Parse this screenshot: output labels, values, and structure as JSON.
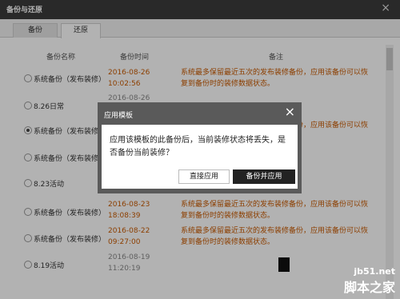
{
  "window": {
    "title": "备份与还原",
    "close": "×"
  },
  "tabs": [
    {
      "label": "备份"
    },
    {
      "label": "还原"
    }
  ],
  "table": {
    "headers": {
      "name": "备份名称",
      "time": "备份时间",
      "note": "备注"
    },
    "rows": [
      {
        "name": "系统备份（发布装修）",
        "date": "2016-08-26",
        "time": "10:02:56",
        "note": "系统最多保留最近五次的发布装修备份，应用该备份可以恢复到备份时的装修数据状态。",
        "selected": false
      },
      {
        "name": "8.26日常",
        "date": "2016-08-26",
        "time": "",
        "note": "",
        "selected": false
      },
      {
        "name": "系统备份（发布装修）",
        "date": "",
        "time": "",
        "note": "系统最多保留最近五次的发布装修备份，应用该备份可以恢复到备份时的装修数据状态。",
        "selected": true
      },
      {
        "name": "系统备份（发布装修）",
        "date": "",
        "time": "",
        "note": "",
        "selected": false
      },
      {
        "name": "8.23活动",
        "date": "",
        "time": "",
        "note": "",
        "selected": false
      },
      {
        "name": "系统备份（发布装修）",
        "date": "2016-08-23",
        "time": "18:08:39",
        "note": "系统最多保留最近五次的发布装修备份，应用该备份可以恢复到备份时的装修数据状态。",
        "selected": false
      },
      {
        "name": "系统备份（发布装修）",
        "date": "2016-08-22",
        "time": "09:27:00",
        "note": "系统最多保留最近五次的发布装修备份，应用该备份可以恢复到备份时的装修数据状态。",
        "selected": false
      },
      {
        "name": "8.19活动",
        "date": "2016-08-19",
        "time": "11:20:19",
        "note": "",
        "selected": false
      }
    ]
  },
  "modal": {
    "title": "应用模板",
    "close": "×",
    "message": "应用该模板的此备份后，当前装修状态将丢失，是否备份当前装修？",
    "btn_apply": "直接应用",
    "btn_backup_apply": "备份并应用"
  },
  "watermark": {
    "line1": "jb51.net",
    "line2": "脚本之家"
  }
}
